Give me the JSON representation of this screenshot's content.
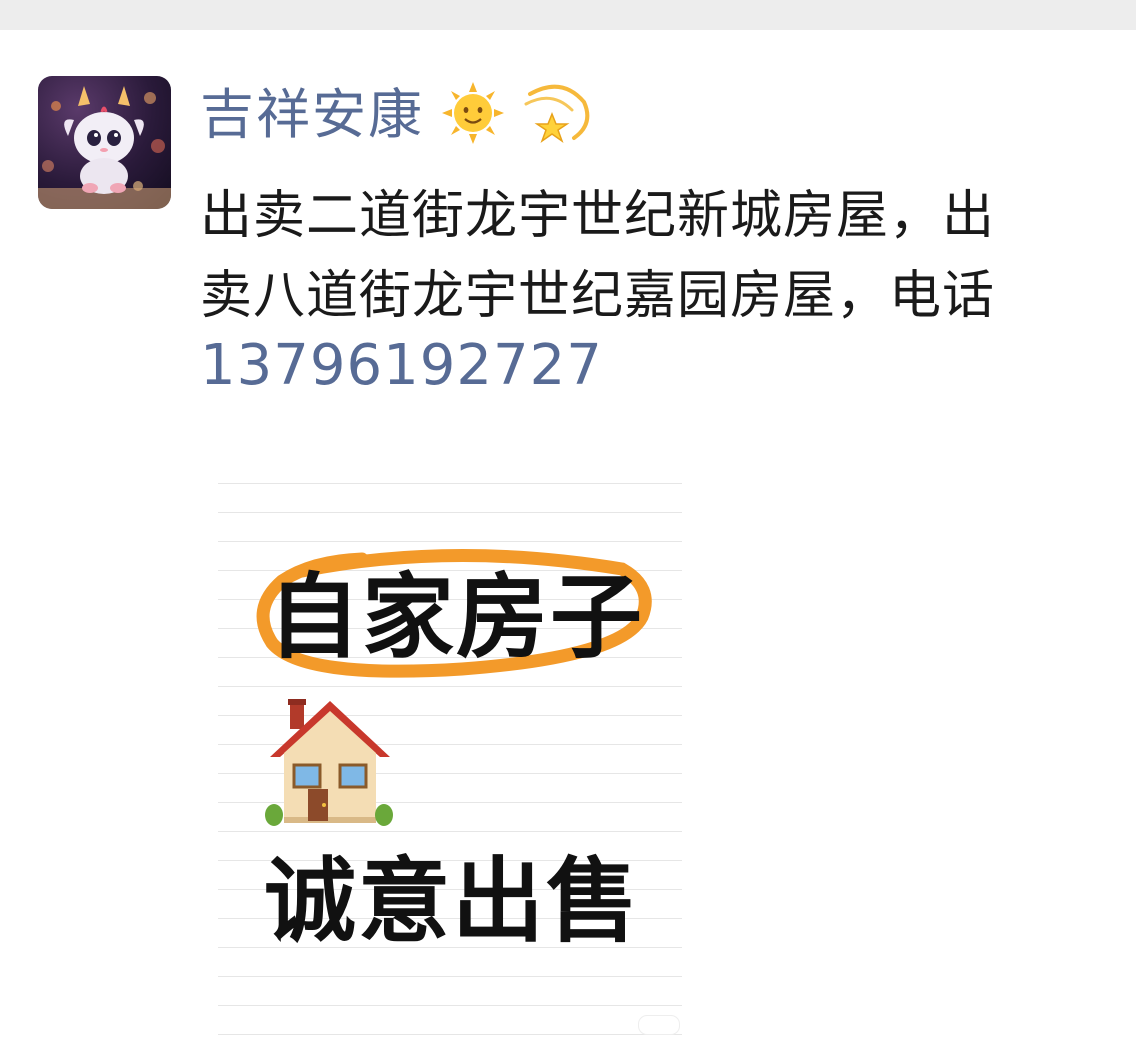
{
  "post": {
    "username": "吉祥安康",
    "username_emojis": [
      "sun-with-face-icon",
      "dizzy-star-icon"
    ],
    "text_line1": "出卖二道街龙宇世纪新城房屋，出",
    "text_line2": "卖八道街龙宇世纪嘉园房屋，电话",
    "phone": "13796192727"
  },
  "image": {
    "title": "自家房子",
    "subtitle": "诚意出售",
    "icon": "house-icon"
  },
  "colors": {
    "link_blue": "#576b95",
    "highlight_orange": "#f39a2a",
    "topbar_gray": "#ededed"
  }
}
